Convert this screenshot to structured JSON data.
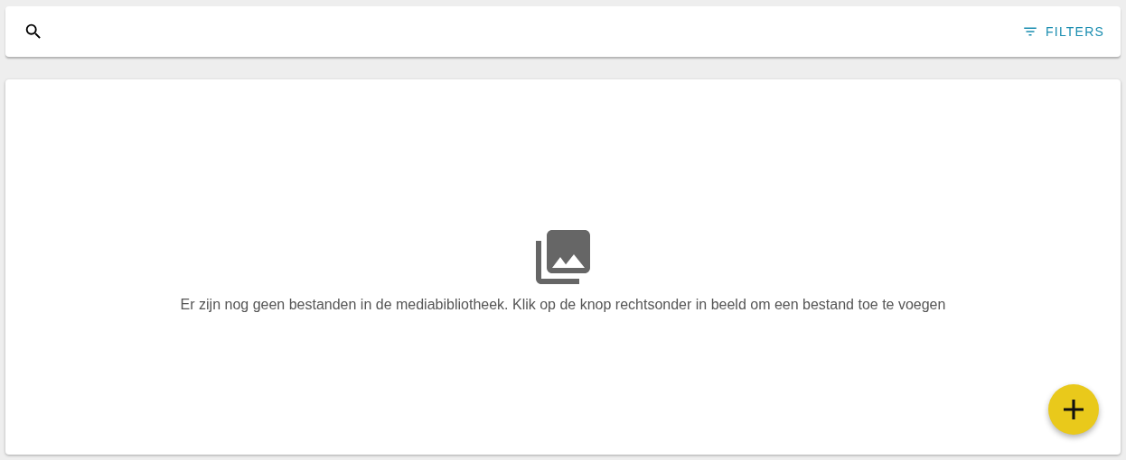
{
  "toolbar": {
    "filters_button": {
      "label": "FILTERS"
    }
  },
  "empty_state": {
    "message": "Er zijn nog geen bestanden in de mediabibliotheek. Klik op de knop rechtsonder in beeld om een bestand toe te voegen"
  }
}
